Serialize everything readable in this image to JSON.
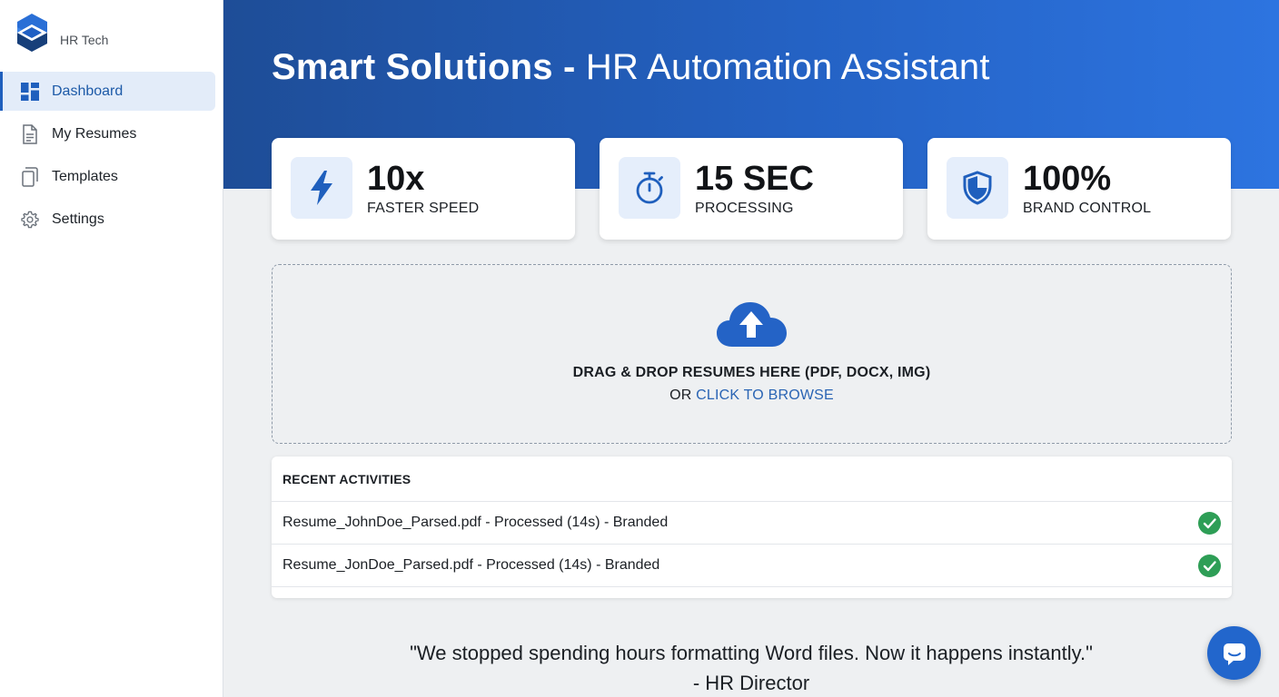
{
  "sidebar": {
    "brand_name": "HR Tech",
    "items": [
      {
        "label": "Dashboard",
        "icon": "dashboard-icon",
        "active": true
      },
      {
        "label": "My Resumes",
        "icon": "document-icon",
        "active": false
      },
      {
        "label": "Templates",
        "icon": "copy-icon",
        "active": false
      },
      {
        "label": "Settings",
        "icon": "gear-icon",
        "active": false
      }
    ]
  },
  "header": {
    "title_bold": "Smart Solutions",
    "title_sep": " - ",
    "title_rest": "HR Automation Assistant"
  },
  "stats": [
    {
      "value": "10x",
      "label": "FASTER SPEED",
      "icon": "lightning-icon"
    },
    {
      "value": "15 SEC",
      "label": "PROCESSING",
      "icon": "stopwatch-icon"
    },
    {
      "value": "100%",
      "label": "BRAND CONTROL",
      "icon": "shield-icon"
    }
  ],
  "dropzone": {
    "text": "DRAG & DROP RESUMES HERE (PDF, DOCX, IMG)",
    "or": "OR ",
    "browse": "CLICK TO BROWSE",
    "icon": "cloud-upload-icon"
  },
  "activities": {
    "title": "RECENT ACTIVITIES",
    "rows": [
      {
        "text": "Resume_JohnDoe_Parsed.pdf - Processed (14s) - Branded",
        "status": "success"
      },
      {
        "text": "Resume_JonDoe_Parsed.pdf - Processed (14s) - Branded",
        "status": "success"
      }
    ]
  },
  "quote": {
    "text": "\"We stopped spending hours formatting Word files. Now it happens instantly.\"",
    "author": "- HR Director"
  },
  "colors": {
    "accent": "#1f5fbd",
    "hero_start": "#1e4d97",
    "hero_end": "#2d74e0",
    "success": "#2e9e56"
  }
}
